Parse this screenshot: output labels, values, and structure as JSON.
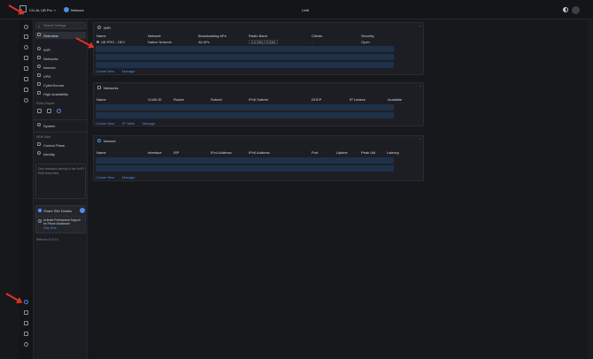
{
  "topbar": {
    "site": "CG-AL UB Pro",
    "app": "Network",
    "title": "Unifi"
  },
  "sidebar": {
    "search_placeholder": "Search Settings",
    "items": [
      {
        "label": "Overview"
      },
      {
        "label": "WiFi"
      },
      {
        "label": "Networks"
      },
      {
        "label": "Internet"
      },
      {
        "label": "VPN"
      },
      {
        "label": "CyberSecure"
      },
      {
        "label": "High Availability"
      }
    ],
    "policy_engine_label": "Policy Engine",
    "system_label": "System",
    "new_ultra_label": "NEW Ultra",
    "control_plane_label": "Control Plane",
    "identity_label": "Identity",
    "feedback_text": "Give feedback directly to the UniFi R&D team here.",
    "share_site_details": "Share Site Details",
    "support_line1": "Activate Professional Support",
    "support_line2": "for Phone Assistance",
    "support_link": "Click Here",
    "version": "Network 10.0.13"
  },
  "wifi": {
    "title": "WiFi",
    "columns": [
      "Name",
      "Network",
      "Broadcasting APs",
      "Radio Band",
      "Clients",
      "Security"
    ],
    "row": {
      "name": "UB PRO - DEV",
      "network": "Native Network",
      "aps": "All APs",
      "band1": "2.4 GHz",
      "band2": "5 GHz",
      "clients": "-",
      "security": "Open"
    },
    "actions": [
      "Create New",
      "Manage"
    ]
  },
  "networks": {
    "title": "Networks",
    "columns": [
      "Name",
      "VLAN ID",
      "Router",
      "Subnet",
      "IPv6 Subnet",
      "DHCP",
      "IP Leases",
      "Available"
    ],
    "actions": [
      "Create New",
      "IP Table",
      "Manage"
    ]
  },
  "internet": {
    "title": "Internet",
    "columns": [
      "Name",
      "Interface",
      "ISP",
      "IPv4 Address",
      "IPv6 Address",
      "Port",
      "Uptime",
      "Peak Util.",
      "Latency"
    ],
    "actions": [
      "Create New",
      "Manage"
    ]
  },
  "colors": {
    "accent": "#4f8be8",
    "arrow": "#e03124",
    "row_highlight": "#1f3149"
  }
}
